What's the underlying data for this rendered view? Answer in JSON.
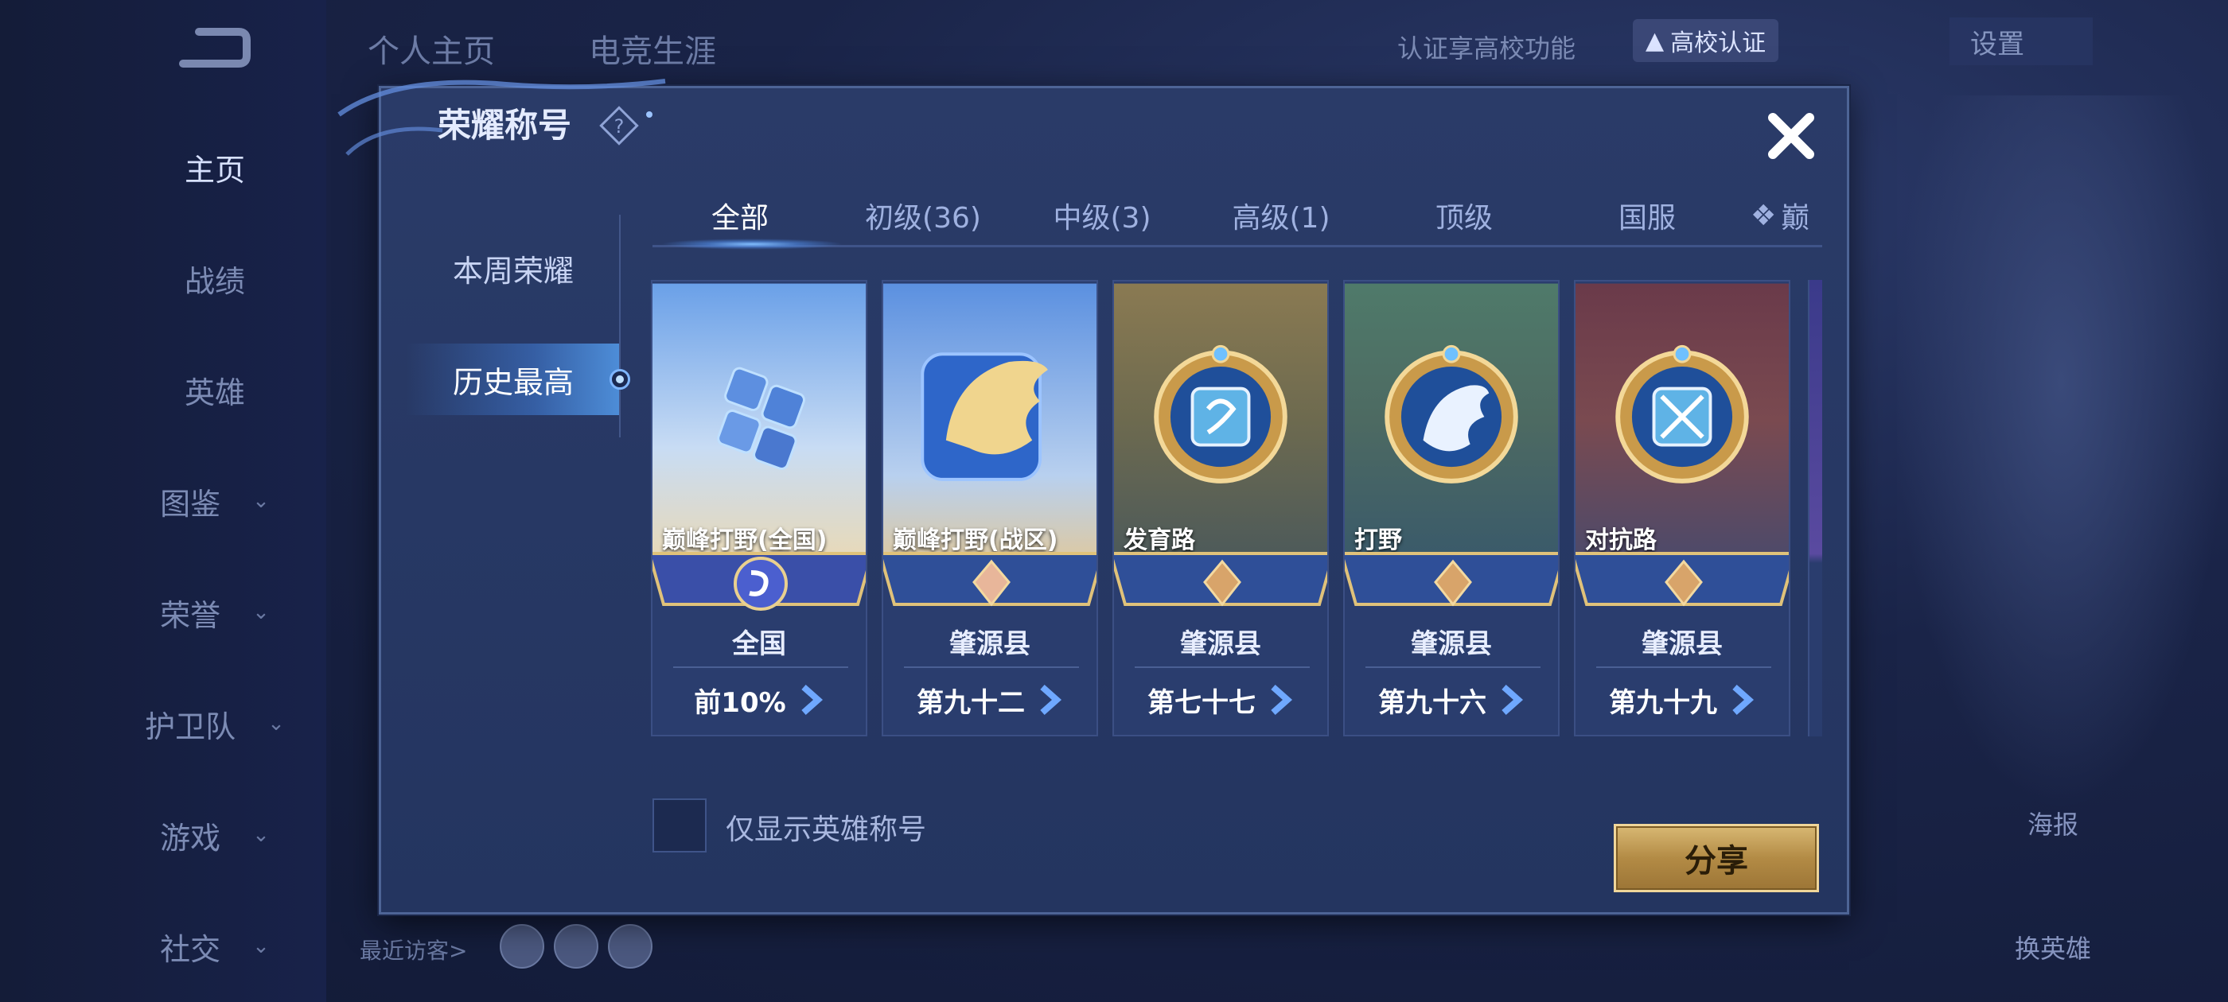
{
  "background": {
    "top_tabs": [
      "个人主页",
      "电竞生涯"
    ],
    "cert_prompt": "认证享高校功能",
    "cert_badge": "高校认证",
    "settings": "设置",
    "nav": [
      {
        "label": "主页"
      },
      {
        "label": "战绩"
      },
      {
        "label": "英雄"
      },
      {
        "label": "图鉴"
      },
      {
        "label": "荣誉"
      },
      {
        "label": "护卫队"
      },
      {
        "label": "游戏"
      },
      {
        "label": "社交"
      }
    ],
    "recent_visitors": "最近访客>",
    "right_actions": [
      "海报",
      "换英雄"
    ]
  },
  "modal": {
    "title": "荣耀称号",
    "side_tabs": [
      "本周荣耀",
      "历史最高"
    ],
    "tabs": [
      "全部",
      "初级(36)",
      "中级(3)",
      "高级(1)",
      "顶级",
      "国服",
      "巅"
    ],
    "cards": [
      {
        "name": "巅峰打野(全国)",
        "region": "全国",
        "rank": "前10%"
      },
      {
        "name": "巅峰打野(战区)",
        "region": "肇源县",
        "rank": "第九十二"
      },
      {
        "name": "发育路",
        "region": "肇源县",
        "rank": "第七十七"
      },
      {
        "name": "打野",
        "region": "肇源县",
        "rank": "第九十六"
      },
      {
        "name": "对抗路",
        "region": "肇源县",
        "rank": "第九十九"
      }
    ],
    "checkbox_label": "仅显示英雄称号",
    "share": "分享"
  },
  "colors": {
    "modal_bg": "#2a3b68",
    "accent_gold": "#d8b873",
    "accent_blue": "#7fb6ff"
  }
}
